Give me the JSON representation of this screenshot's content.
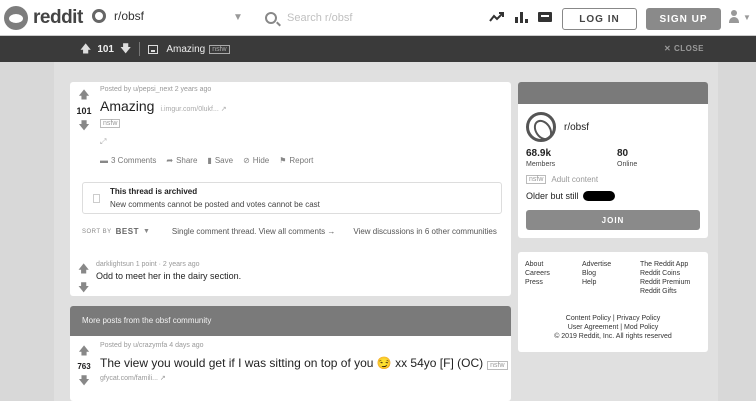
{
  "header": {
    "logo_text": "reddit",
    "subreddit_selector": "r/obsf",
    "search_placeholder": "Search r/obsf",
    "login_label": "LOG IN",
    "signup_label": "SIGN UP"
  },
  "post_bar": {
    "score": "101",
    "title": "Amazing",
    "nsfw": "nsfw",
    "close_label": "✕ CLOSE"
  },
  "post": {
    "meta": "Posted by u/pepsi_next 2 years ago",
    "score": "101",
    "title": "Amazing",
    "domain": "i.imgur.com/0lukf... ↗",
    "nsfw": "nsfw",
    "actions": {
      "comments": "3 Comments",
      "share": "Share",
      "save": "Save",
      "hide": "Hide",
      "report": "Report"
    }
  },
  "archived": {
    "heading": "This thread is archived",
    "subtext": "New comments cannot be posted and votes cannot be cast"
  },
  "sort": {
    "sort_by": "SORT BY",
    "best": "BEST",
    "single_thread": "Single comment thread. View all comments →",
    "discussions": "View discussions in 6 other communities"
  },
  "comment": {
    "meta": "darklightsun  1 point  ·  2 years ago",
    "text": "Odd to meet her in the dairy section."
  },
  "more_posts": {
    "header": "More posts from the obsf community",
    "meta": "Posted by u/crazymfa 4 days ago",
    "score": "763",
    "title": "The view you would get if I was sitting on top of you 😏 xx 54yo [F] (OC)",
    "nsfw": "nsfw",
    "link": "gfycat.com/famili... ↗"
  },
  "sidebar": {
    "sub_name": "r/obsf",
    "members_value": "68.9k",
    "members_label": "Members",
    "online_value": "80",
    "online_label": "Online",
    "adult_tag": "nsfw",
    "adult_text": "Adult content",
    "description": "Older but still",
    "join_label": "JOIN"
  },
  "footer": {
    "col1": [
      "About",
      "Careers",
      "Press"
    ],
    "col2": [
      "Advertise",
      "Blog",
      "Help"
    ],
    "col3": [
      "The Reddit App",
      "Reddit Coins",
      "Reddit Premium",
      "Reddit Gifts"
    ],
    "policy_line1": "Content Policy | Privacy Policy",
    "policy_line2": "User Agreement | Mod Policy",
    "copyright": "© 2019 Reddit, Inc. All rights reserved"
  }
}
